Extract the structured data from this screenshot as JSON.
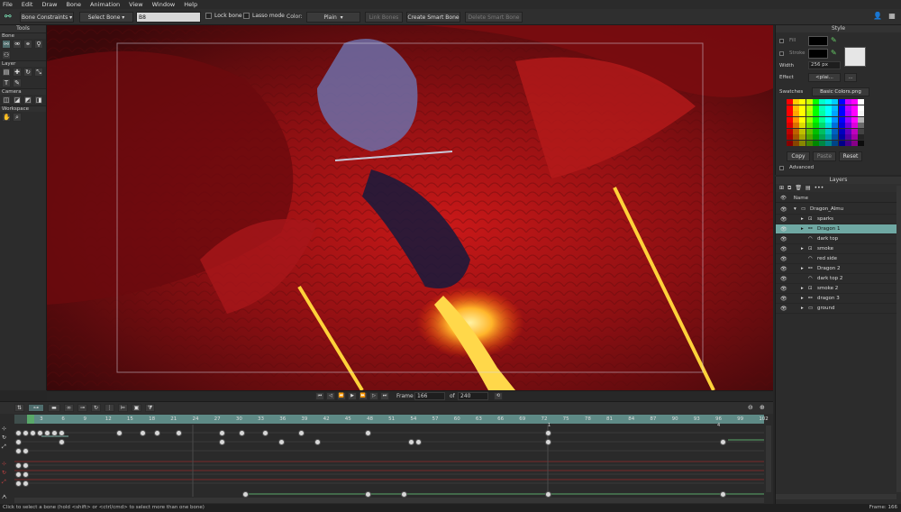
{
  "menu": [
    "File",
    "Edit",
    "Draw",
    "Bone",
    "Animation",
    "View",
    "Window",
    "Help"
  ],
  "toolbar": {
    "mode": "Bone Constraints",
    "select_bone": "Select Bone",
    "bone_name": "B8",
    "lock_bone": "Lock bone",
    "lasso_mode": "Lasso mode",
    "color_label": "Color:",
    "color_value": "Plain",
    "link_bones": "Link Bones",
    "create_smart_bone": "Create Smart Bone",
    "delete_smart_bone": "Delete Smart Bone"
  },
  "tools": {
    "title": "Tools",
    "sections": [
      "Bone",
      "Layer",
      "Camera",
      "Workspace"
    ]
  },
  "style": {
    "title": "Style",
    "fill": "Fill",
    "stroke": "Stroke",
    "width_label": "Width",
    "width_value": "256 px",
    "effect_label": "Effect",
    "effect_value": "<plai...",
    "effect_more": "...",
    "swatches_label": "Swatches",
    "swatches_value": "Basic Colors.png",
    "copy": "Copy",
    "paste": "Paste",
    "reset": "Reset",
    "advanced": "Advanced"
  },
  "layers": {
    "title": "Layers",
    "name_header": "Name",
    "items": [
      {
        "name": "Dragon_Almu",
        "indent": 0,
        "type": "folder",
        "arrow": "▾",
        "selected": false
      },
      {
        "name": "sparks",
        "indent": 1,
        "type": "group",
        "arrow": "▸",
        "selected": false
      },
      {
        "name": "Dragon 1",
        "indent": 1,
        "type": "bone",
        "arrow": "▸",
        "selected": true
      },
      {
        "name": "dark top",
        "indent": 1,
        "type": "vector",
        "arrow": "",
        "selected": false
      },
      {
        "name": "smoke",
        "indent": 1,
        "type": "group",
        "arrow": "▸",
        "selected": false
      },
      {
        "name": "red side",
        "indent": 1,
        "type": "vector",
        "arrow": "",
        "selected": false
      },
      {
        "name": "Dragon 2",
        "indent": 1,
        "type": "bone",
        "arrow": "▸",
        "selected": false
      },
      {
        "name": "dark top 2",
        "indent": 1,
        "type": "vector",
        "arrow": "",
        "selected": false
      },
      {
        "name": "smoke 2",
        "indent": 1,
        "type": "group",
        "arrow": "▸",
        "selected": false
      },
      {
        "name": "dragon 3",
        "indent": 1,
        "type": "bone",
        "arrow": "▸",
        "selected": false
      },
      {
        "name": "ground",
        "indent": 1,
        "type": "folder",
        "arrow": "▸",
        "selected": false
      }
    ]
  },
  "playback": {
    "frame_label": "Frame",
    "frame_value": "166",
    "of_label": "of",
    "total_value": "240"
  },
  "timeline": {
    "ticks": [
      "0",
      "3",
      "6",
      "9",
      "12",
      "15",
      "18",
      "21",
      "24",
      "27",
      "30",
      "33",
      "36",
      "39",
      "42",
      "45",
      "48",
      "51",
      "54",
      "57",
      "60",
      "63",
      "66",
      "69",
      "72",
      "75",
      "78",
      "81",
      "84",
      "87",
      "90",
      "93",
      "96",
      "99",
      "102"
    ],
    "markers": [
      "4",
      "1"
    ]
  },
  "status": {
    "hint": "Click to select a bone (hold <shift> or <ctrl/cmd> to select more than one bone)",
    "frame_readout": "Frame: 166"
  },
  "colors": {
    "selection": "#6fa8a3",
    "timeline_bar": "#5e8a86",
    "accent_green": "#59a869"
  }
}
